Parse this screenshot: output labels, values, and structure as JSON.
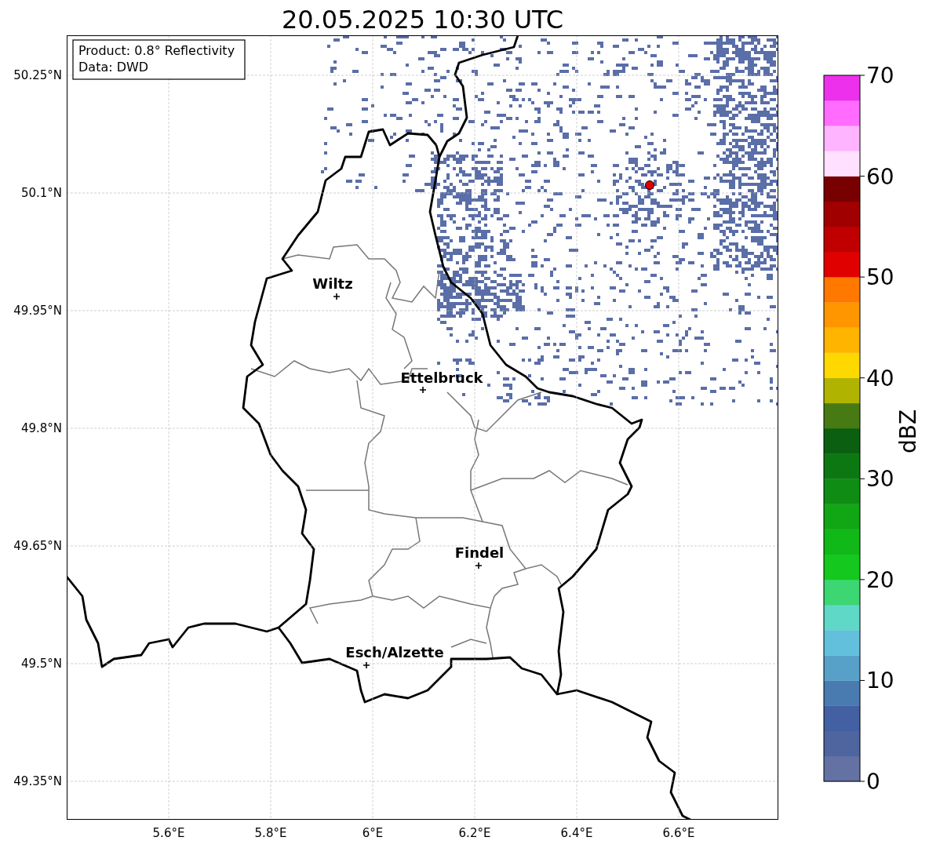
{
  "title": "20.05.2025 10:30 UTC",
  "info_box": {
    "lines": [
      "Product: 0.8° Reflectivity",
      "Data: DWD"
    ]
  },
  "y_ticks": [
    "50.25°N",
    "50.1°N",
    "49.95°N",
    "49.8°N",
    "49.65°N",
    "49.5°N",
    "49.35°N"
  ],
  "x_ticks": [
    "5.6°E",
    "5.8°E",
    "6°E",
    "6.2°E",
    "6.4°E",
    "6.6°E"
  ],
  "cities": [
    {
      "name": "Wiltz"
    },
    {
      "name": "Ettelbruck"
    },
    {
      "name": "Findel"
    },
    {
      "name": "Esch/Alzette"
    }
  ],
  "colorbar": {
    "label": "dBZ",
    "ticks": [
      "70",
      "60",
      "50",
      "40",
      "30",
      "20",
      "10",
      "0"
    ],
    "bins": [
      {
        "color": "#6371a3"
      },
      {
        "color": "#4f65a0"
      },
      {
        "color": "#4360a3"
      },
      {
        "color": "#4a7bb0"
      },
      {
        "color": "#57a0c8"
      },
      {
        "color": "#62c0dd"
      },
      {
        "color": "#5fd8c8"
      },
      {
        "color": "#3cd672"
      },
      {
        "color": "#14c81e"
      },
      {
        "color": "#10b818"
      },
      {
        "color": "#10a614"
      },
      {
        "color": "#0e8c14"
      },
      {
        "color": "#0c7812"
      },
      {
        "color": "#0a6010"
      },
      {
        "color": "#487a14"
      },
      {
        "color": "#b0b400"
      },
      {
        "color": "#ffd800"
      },
      {
        "color": "#ffb400"
      },
      {
        "color": "#ff9600"
      },
      {
        "color": "#ff7800"
      },
      {
        "color": "#e00000"
      },
      {
        "color": "#c00000"
      },
      {
        "color": "#a00000"
      },
      {
        "color": "#780000"
      },
      {
        "color": "#ffe0ff"
      },
      {
        "color": "#ffb4ff"
      },
      {
        "color": "#ff6cff"
      },
      {
        "color": "#ec30ec"
      }
    ]
  }
}
